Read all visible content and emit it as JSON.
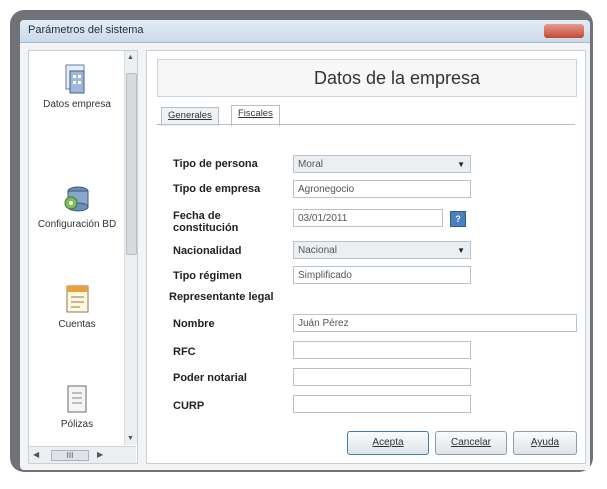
{
  "window": {
    "title": "Parámetros del sistema"
  },
  "sidebar": {
    "items": [
      {
        "label": "Datos empresa",
        "icon": "building-document-icon"
      },
      {
        "label": "Configuración BD",
        "icon": "database-config-icon"
      },
      {
        "label": "Cuentas",
        "icon": "ledger-icon"
      },
      {
        "label": "Pólizas",
        "icon": "policy-document-icon"
      }
    ],
    "hscroll_label": "III"
  },
  "header": {
    "title": "Datos de la empresa"
  },
  "tabs": [
    {
      "label": "Generales",
      "active": false
    },
    {
      "label": "Fiscales",
      "active": true
    }
  ],
  "form": {
    "tipo_persona": {
      "label": "Tipo de persona",
      "value": "Moral"
    },
    "tipo_empresa": {
      "label": "Tipo de empresa",
      "value": "Agronegocio"
    },
    "fecha_constitucion": {
      "label": "Fecha de constitución",
      "value": "03/01/2011"
    },
    "nacionalidad": {
      "label": "Nacionalidad",
      "value": "Nacional"
    },
    "tipo_regimen": {
      "label": "Tipo régimen",
      "value": "Simplificado"
    },
    "representante_legal": {
      "label": "Representante legal"
    },
    "nombre": {
      "label": "Nombre",
      "value": "Juán Pérez"
    },
    "rfc": {
      "label": "RFC",
      "value": ""
    },
    "poder_notarial": {
      "label": "Poder notarial",
      "value": ""
    },
    "curp": {
      "label": "CURP",
      "value": ""
    }
  },
  "buttons": {
    "aceptar": "Acepta",
    "cancelar": "Cancelar",
    "ayuda": "Ayuda"
  },
  "colors": {
    "frame": "#6f7378",
    "accent": "#3c7fb1"
  }
}
